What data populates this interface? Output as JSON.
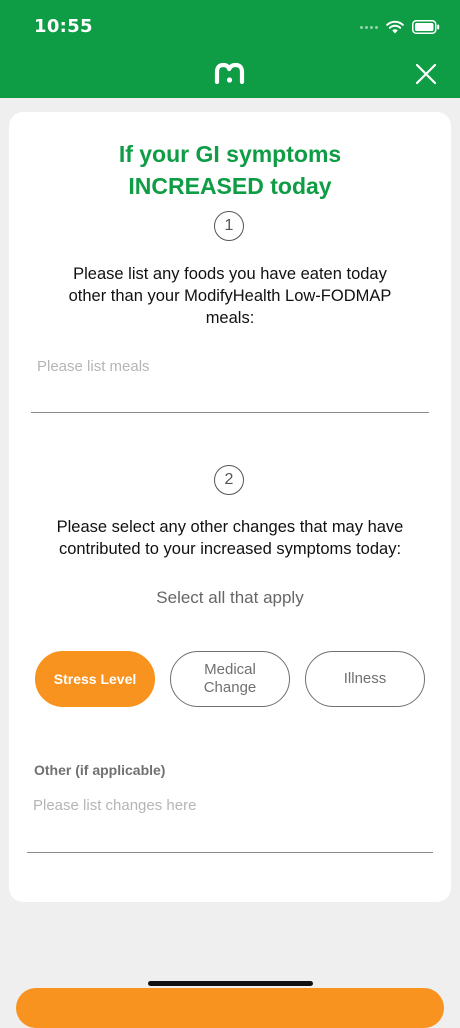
{
  "status_bar": {
    "time": "10:55"
  },
  "header": {
    "logo_icon": "modifyhealth-logo-icon",
    "close_icon": "close-icon",
    "brand_color": "#0e9c45"
  },
  "form": {
    "title_line1": "If your GI symptoms",
    "title_line2": "INCREASED today",
    "step1": {
      "number": "1",
      "prompt_line1": "Please list any foods you have eaten today",
      "prompt_line2": "other than your ModifyHealth Low-FODMAP",
      "prompt_line3": "meals:",
      "input_value": "",
      "input_placeholder": "Please list meals"
    },
    "step2": {
      "number": "2",
      "prompt_line1": "Please select any other changes that may have",
      "prompt_line2": "contributed to your increased symptoms today:",
      "select_note": "Select all that apply",
      "options": [
        {
          "label": "Stress Level",
          "selected": true
        },
        {
          "label": "Medical\nChange",
          "selected": false
        },
        {
          "label": "Illness",
          "selected": false
        }
      ],
      "accent_color": "#f7931e"
    },
    "other": {
      "label": "Other (if applicable)",
      "input_value": "",
      "input_placeholder": "Please list changes here"
    }
  }
}
